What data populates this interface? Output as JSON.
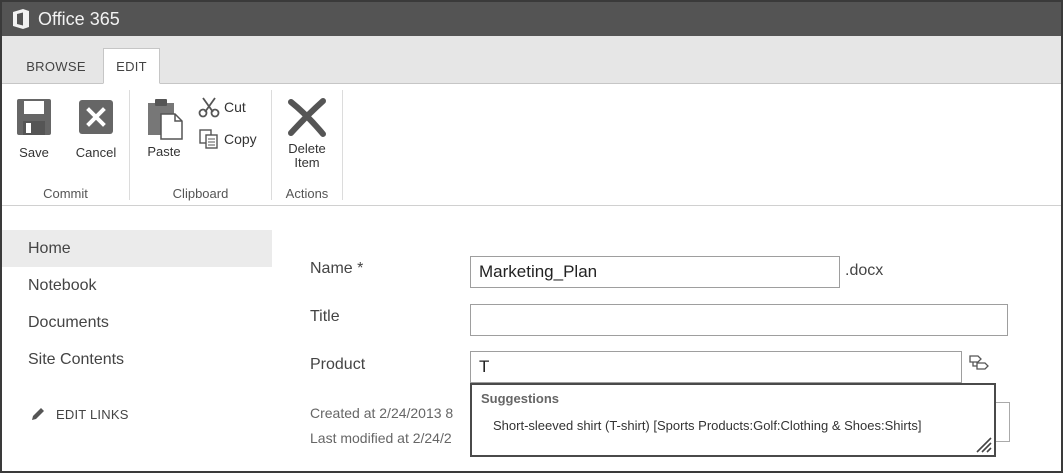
{
  "app": {
    "title": "Office 365"
  },
  "tabs": [
    {
      "label": "BROWSE",
      "selected": false
    },
    {
      "label": "EDIT",
      "selected": true
    }
  ],
  "ribbon": {
    "commit": {
      "label": "Commit",
      "save": "Save",
      "cancel": "Cancel"
    },
    "clipboard": {
      "label": "Clipboard",
      "paste": "Paste",
      "cut": "Cut",
      "copy": "Copy"
    },
    "actions": {
      "label": "Actions",
      "delete_line1": "Delete",
      "delete_line2": "Item"
    }
  },
  "nav": {
    "items": [
      {
        "label": "Home",
        "active": true
      },
      {
        "label": "Notebook"
      },
      {
        "label": "Documents"
      },
      {
        "label": "Site Contents"
      }
    ],
    "edit_links": "EDIT LINKS"
  },
  "form": {
    "name": {
      "label": "Name *",
      "value": "Marketing_Plan",
      "suffix": ".docx"
    },
    "title": {
      "label": "Title",
      "value": ""
    },
    "product": {
      "label": "Product",
      "value": "T"
    },
    "created": "Created at 2/24/2013 8",
    "modified": "Last modified at 2/24/2"
  },
  "suggestions": {
    "header": "Suggestions",
    "items": [
      "Short-sleeved shirt (T-shirt)  [Sports Products:Golf:Clothing  &  Shoes:Shirts]"
    ]
  },
  "colors": {
    "topbar": "#545454",
    "tabstrip": "#e6e6e6",
    "icon_gray": "#666666",
    "active_nav": "#ebebeb"
  }
}
